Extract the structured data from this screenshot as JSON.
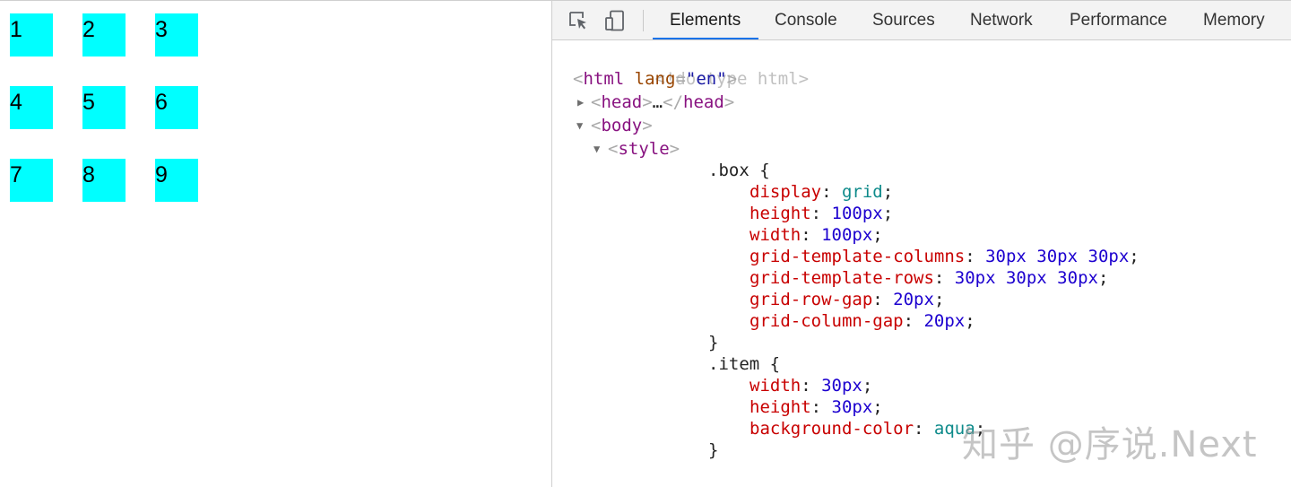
{
  "viewport": {
    "items": [
      "1",
      "2",
      "3",
      "4",
      "5",
      "6",
      "7",
      "8",
      "9"
    ],
    "item_color": "#00ffff"
  },
  "devtools": {
    "icons": [
      "inspect-element-icon",
      "device-toolbar-icon"
    ],
    "tabs": [
      "Elements",
      "Console",
      "Sources",
      "Network",
      "Performance",
      "Memory"
    ],
    "active_tab": "Elements",
    "accent": "#1a73e8",
    "dom": {
      "doctype": "<!doctype html>",
      "html_open_tag": "html",
      "html_attr_name": "lang",
      "html_attr_value": "\"en\"",
      "head_tag": "head",
      "head_ellipsis": "…",
      "body_tag": "body",
      "style_tag": "style"
    },
    "css": {
      "box_selector": ".box {",
      "box_rules": [
        {
          "prop": "display",
          "value": "grid",
          "kind": "kw"
        },
        {
          "prop": "height",
          "value": "100px",
          "kind": "num"
        },
        {
          "prop": "width",
          "value": "100px",
          "kind": "num"
        },
        {
          "prop": "grid-template-columns",
          "value": "30px 30px 30px",
          "kind": "num"
        },
        {
          "prop": "grid-template-rows",
          "value": "30px 30px 30px",
          "kind": "num"
        },
        {
          "prop": "grid-row-gap",
          "value": "20px",
          "kind": "num"
        },
        {
          "prop": "grid-column-gap",
          "value": "20px",
          "kind": "num"
        }
      ],
      "close_brace": "}",
      "item_selector": ".item {",
      "item_rules": [
        {
          "prop": "width",
          "value": "30px",
          "kind": "num"
        },
        {
          "prop": "height",
          "value": "30px",
          "kind": "num"
        },
        {
          "prop": "background-color",
          "value": "aqua",
          "kind": "kw"
        }
      ]
    }
  },
  "watermark": "知乎 @序说.Next"
}
